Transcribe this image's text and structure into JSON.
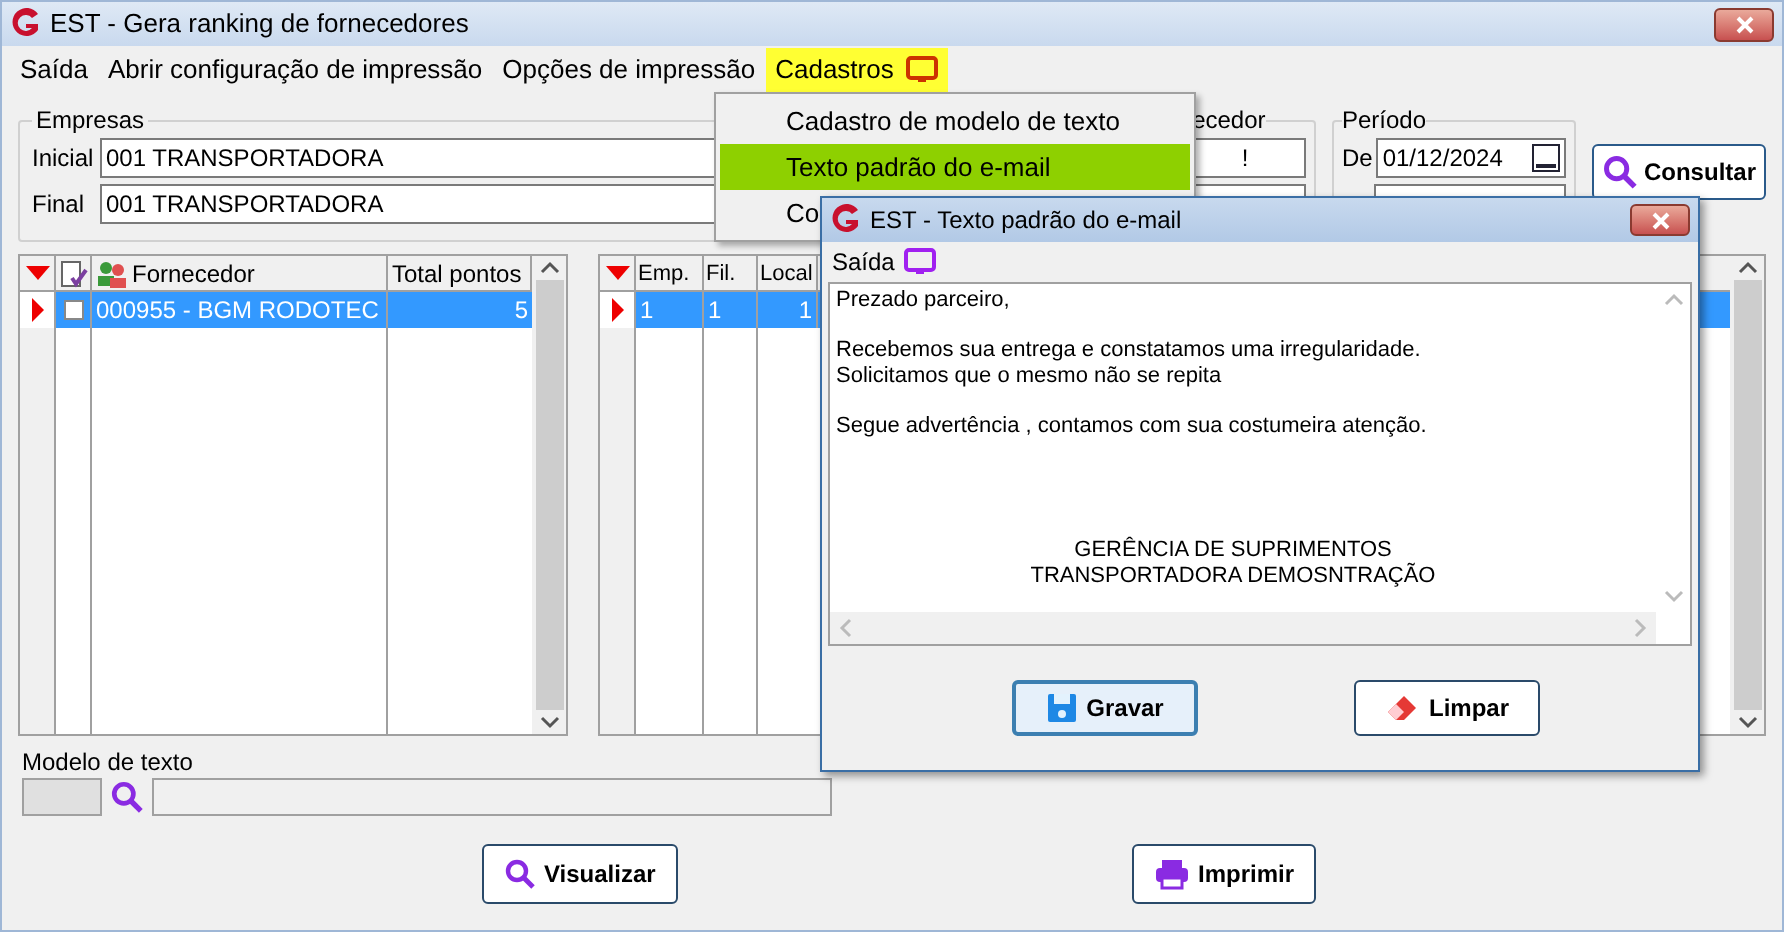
{
  "window": {
    "title": "EST - Gera ranking de fornecedores"
  },
  "menu": [
    {
      "label": "Saída",
      "selected": false
    },
    {
      "label": "Abrir configuração de impressão",
      "selected": false
    },
    {
      "label": "Opções de impressão",
      "selected": false
    },
    {
      "label": "Cadastros",
      "selected": true
    }
  ],
  "dropdown": [
    {
      "label": "Cadastro de modelo de texto",
      "selected": false
    },
    {
      "label": "Texto padrão do e-mail",
      "selected": true
    },
    {
      "label": "Co",
      "selected": false
    }
  ],
  "empresas": {
    "label": "Empresas",
    "fields": [
      {
        "label": "Inicial",
        "value": "001 TRANSPORTADORA"
      },
      {
        "label": "Final",
        "value": "001 TRANSPORTADORA"
      }
    ]
  },
  "fornecedor_group": {
    "label": "ecedor",
    "value": "!"
  },
  "periodo": {
    "label": "Período",
    "from_label": "De",
    "from_value": "01/12/2024"
  },
  "consultar": "Consultar",
  "left_grid": {
    "columns": [
      "Fornecedor",
      "Total pontos"
    ],
    "rows": [
      {
        "name": "000955 - BGM RODOTEC",
        "points": "5",
        "selected": true,
        "checked": false
      }
    ]
  },
  "right_grid": {
    "columns": [
      "Emp.",
      "Fil.",
      "Local"
    ],
    "rows": [
      {
        "cells": [
          "1",
          "1",
          "1"
        ],
        "selected": true
      }
    ]
  },
  "modelo": {
    "label": "Modelo de texto"
  },
  "buttons": [
    {
      "label": "Visualizar",
      "kind": "search"
    },
    {
      "label": "Imprimir",
      "kind": "print"
    }
  ],
  "dialog": {
    "title": "EST - Texto padrão do e-mail",
    "menu": "Saída",
    "paragraphs": [
      {
        "kind": "body",
        "lines": [
          "Prezado parceiro,"
        ]
      },
      {
        "kind": "body",
        "lines": [
          "Recebemos sua entrega e constatamos uma irregularidade.",
          "Solicitamos que o mesmo não se repita"
        ]
      },
      {
        "kind": "body",
        "lines": [
          "Segue advertência , contamos com sua costumeira atenção."
        ]
      },
      {
        "kind": "signature",
        "lines": [
          "GERÊNCIA DE SUPRIMENTOS",
          "TRANSPORTADORA DEMOSNTRAÇÃO"
        ]
      }
    ],
    "buttons": [
      {
        "label": "Gravar",
        "kind": "save",
        "default": true
      },
      {
        "label": "Limpar",
        "kind": "eraser",
        "default": false
      }
    ]
  }
}
